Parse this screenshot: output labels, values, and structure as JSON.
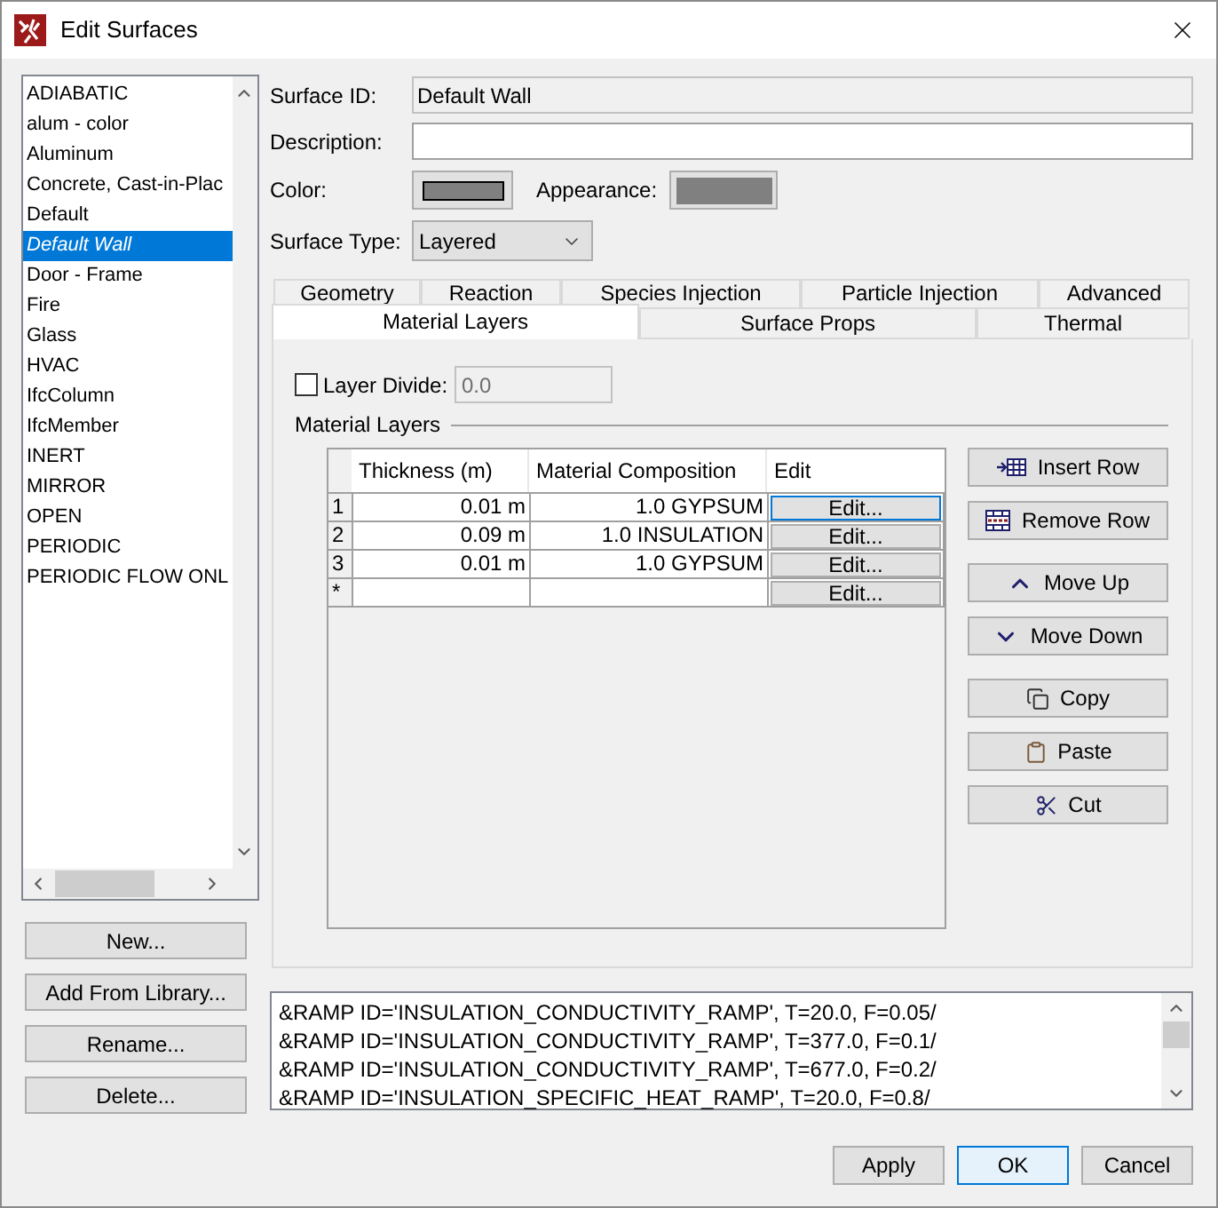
{
  "window": {
    "title": "Edit Surfaces"
  },
  "surfaces": [
    {
      "label": "ADIABATIC",
      "selected": false
    },
    {
      "label": "alum - color",
      "selected": false
    },
    {
      "label": "Aluminum",
      "selected": false
    },
    {
      "label": "Concrete, Cast-in-Plac",
      "selected": false
    },
    {
      "label": "Default",
      "selected": false
    },
    {
      "label": "Default Wall",
      "selected": true
    },
    {
      "label": "Door - Frame",
      "selected": false
    },
    {
      "label": "Fire",
      "selected": false
    },
    {
      "label": "Glass",
      "selected": false
    },
    {
      "label": "HVAC",
      "selected": false
    },
    {
      "label": "IfcColumn",
      "selected": false
    },
    {
      "label": "IfcMember",
      "selected": false
    },
    {
      "label": "INERT",
      "selected": false
    },
    {
      "label": "MIRROR",
      "selected": false
    },
    {
      "label": "OPEN",
      "selected": false
    },
    {
      "label": "PERIODIC",
      "selected": false
    },
    {
      "label": "PERIODIC FLOW ONL",
      "selected": false
    }
  ],
  "surface_buttons": [
    "New...",
    "Add From Library...",
    "Rename...",
    "Delete..."
  ],
  "surface_id": {
    "label": "Surface ID:",
    "value": "Default Wall",
    "disabled": true
  },
  "description": {
    "label": "Description:",
    "disabled": false
  },
  "color": {
    "label": "Color:",
    "color": "#808080"
  },
  "appearance": {
    "label": "Appearance:",
    "color": "#808080"
  },
  "surface_type": {
    "label": "Surface Type:",
    "value": "Layered"
  },
  "tabs": {
    "back_row": [
      {
        "label": "Geometry",
        "selected": false
      },
      {
        "label": "Reaction",
        "selected": false
      },
      {
        "label": "Species Injection",
        "selected": false
      },
      {
        "label": "Particle Injection",
        "selected": false
      },
      {
        "label": "Advanced",
        "selected": false
      }
    ],
    "front_row": [
      {
        "label": "Material Layers",
        "selected": true
      },
      {
        "label": "Surface Props",
        "selected": false
      },
      {
        "label": "Thermal",
        "selected": false
      }
    ]
  },
  "layer_divide": {
    "label": "Layer Divide:",
    "checked": false,
    "value": "0.0",
    "disabled": true
  },
  "material_layers": {
    "title": "Material Layers",
    "columns": [
      "Thickness (m)",
      "Material Composition",
      "Edit"
    ],
    "rows": [
      {
        "number": "1",
        "thickness": "0.01 m",
        "composition": "1.0 GYPSUM",
        "action": "Edit...",
        "focused": true
      },
      {
        "number": "2",
        "thickness": "0.09 m",
        "composition": "1.0 INSULATION",
        "action": "Edit...",
        "focused": false
      },
      {
        "number": "3",
        "thickness": "0.01 m",
        "composition": "1.0 GYPSUM",
        "action": "Edit...",
        "focused": false
      },
      {
        "number": "*",
        "action": "Edit...",
        "focused": false
      }
    ]
  },
  "row_buttons": [
    [
      {
        "kind": "insert",
        "label": "Insert Row"
      },
      {
        "kind": "remove",
        "label": "Remove Row"
      }
    ],
    [
      {
        "kind": "up",
        "label": "Move Up"
      },
      {
        "kind": "down",
        "label": "Move Down"
      }
    ],
    [
      {
        "kind": "copy",
        "label": "Copy"
      },
      {
        "kind": "paste",
        "label": "Paste"
      },
      {
        "kind": "cut",
        "label": "Cut"
      }
    ]
  ],
  "output": {
    "lines": [
      "&RAMP ID='INSULATION_CONDUCTIVITY_RAMP', T=20.0, F=0.05/",
      "&RAMP ID='INSULATION_CONDUCTIVITY_RAMP', T=377.0, F=0.1/",
      "&RAMP ID='INSULATION_CONDUCTIVITY_RAMP', T=677.0, F=0.2/",
      "&RAMP ID='INSULATION_SPECIFIC_HEAT_RAMP', T=20.0, F=0.8/"
    ]
  },
  "dialog_buttons": [
    {
      "label": "Apply",
      "default": false
    },
    {
      "label": "OK",
      "default": true
    },
    {
      "label": "Cancel",
      "default": false
    }
  ]
}
